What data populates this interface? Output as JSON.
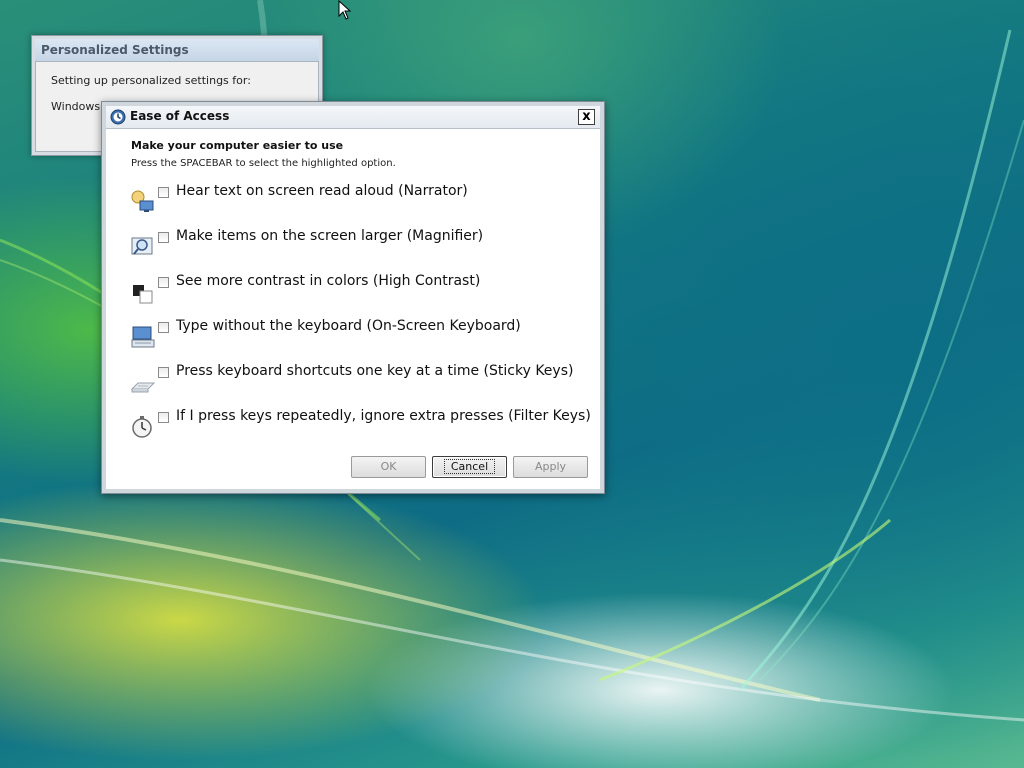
{
  "personalized_settings": {
    "title": "Personalized Settings",
    "line1": "Setting up personalized settings for:",
    "line2": "Windows D"
  },
  "ease_of_access": {
    "title": "Ease of Access",
    "heading": "Make your computer easier to use",
    "subheading": "Press the SPACEBAR to select the highlighted option.",
    "close_label": "x",
    "options": [
      {
        "label": "Hear text on screen read aloud (Narrator)",
        "icon": "narrator-icon",
        "checked": false
      },
      {
        "label": "Make items on the screen larger (Magnifier)",
        "icon": "magnifier-icon",
        "checked": false
      },
      {
        "label": "See more contrast in colors (High Contrast)",
        "icon": "high-contrast-icon",
        "checked": false
      },
      {
        "label": "Type without the keyboard (On-Screen Keyboard)",
        "icon": "on-screen-keyboard-icon",
        "checked": false
      },
      {
        "label": "Press keyboard shortcuts one key at a time (Sticky Keys)",
        "icon": "sticky-keys-icon",
        "checked": false
      },
      {
        "label": "If I press keys repeatedly, ignore extra presses (Filter Keys)",
        "icon": "filter-keys-icon",
        "checked": false
      }
    ],
    "buttons": {
      "ok": "OK",
      "cancel": "Cancel",
      "apply": "Apply"
    }
  }
}
